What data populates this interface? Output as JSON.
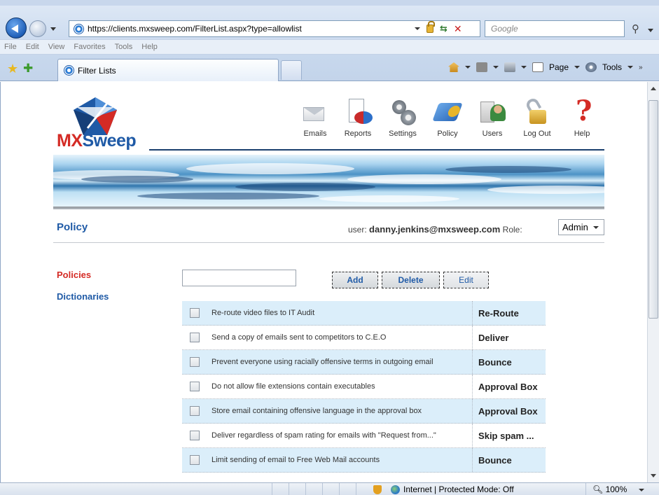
{
  "browser": {
    "url": "https://clients.mxsweep.com/FilterList.aspx?type=allowlist",
    "search_placeholder": "Google",
    "menu": [
      "File",
      "Edit",
      "View",
      "Favorites",
      "Tools",
      "Help"
    ],
    "tab_title": "Filter Lists",
    "commands": {
      "page": "Page",
      "tools": "Tools"
    },
    "status": {
      "zone": "Internet | Protected Mode: Off",
      "zoom": "100%"
    }
  },
  "header": {
    "logo_mx": "MX",
    "logo_sweep": "Sweep",
    "nav": [
      {
        "label": "Emails",
        "icon": "envelope-icon"
      },
      {
        "label": "Reports",
        "icon": "report-chart-icon"
      },
      {
        "label": "Settings",
        "icon": "gears-icon"
      },
      {
        "label": "Policy",
        "icon": "policy-icon"
      },
      {
        "label": "Users",
        "icon": "users-icon"
      },
      {
        "label": "Log Out",
        "icon": "padlock-icon"
      },
      {
        "label": "Help",
        "icon": "question-mark-icon"
      }
    ]
  },
  "page": {
    "title": "Policy",
    "user_label": "user:",
    "user_email": "danny.jenkins@mxsweep.com",
    "role_label": "Role:",
    "role_value": "Admin"
  },
  "sidebar": {
    "items": [
      {
        "label": "Policies",
        "active": true
      },
      {
        "label": "Dictionaries",
        "active": false
      }
    ]
  },
  "toolbar": {
    "filter_input_value": "",
    "add_label": "Add",
    "delete_label": "Delete",
    "edit_label": "Edit"
  },
  "rules": [
    {
      "description": "Re-route video files to IT Audit",
      "action": "Re-Route",
      "checked": false
    },
    {
      "description": "Send a copy of emails sent to competitors to C.E.O",
      "action": "Deliver",
      "checked": false
    },
    {
      "description": "Prevent everyone using racially offensive terms in outgoing email",
      "action": "Bounce",
      "checked": false
    },
    {
      "description": "Do not allow file extensions contain executables",
      "action": "Approval Box",
      "checked": false
    },
    {
      "description": "Store email containing offensive language in the approval box",
      "action": "Approval Box",
      "checked": false
    },
    {
      "description": "Deliver regardless of spam rating for emails with \"Request from...\"",
      "action": "Skip spam ...",
      "checked": false
    },
    {
      "description": "Limit sending of email to Free Web Mail accounts",
      "action": "Bounce",
      "checked": false
    }
  ],
  "colors": {
    "brand_red": "#d42b25",
    "brand_blue": "#1f5aa6",
    "row_highlight": "#dbeefa"
  }
}
